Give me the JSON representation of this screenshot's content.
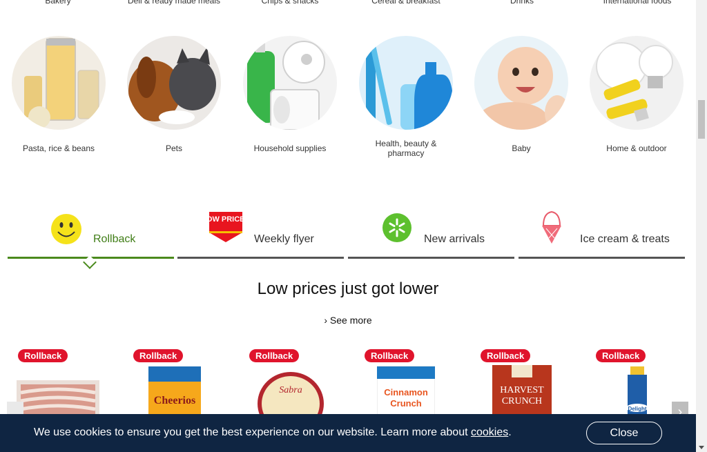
{
  "top_categories": [
    "Bakery",
    "Deli & ready made meals",
    "Chips & snacks",
    "Cereal & breakfast",
    "Drinks",
    "International foods"
  ],
  "categories": [
    {
      "label": "Pasta, rice & beans",
      "icon": "pasta-jars-image"
    },
    {
      "label": "Pets",
      "icon": "pets-image"
    },
    {
      "label": "Household supplies",
      "icon": "household-image"
    },
    {
      "label": "Health, beauty & pharmacy",
      "icon": "health-image"
    },
    {
      "label": "Baby",
      "icon": "baby-image"
    },
    {
      "label": "Home & outdoor",
      "icon": "home-image"
    }
  ],
  "tabs": [
    {
      "label": "Rollback",
      "icon": "smiley-icon",
      "active": true
    },
    {
      "label": "Weekly flyer",
      "icon": "low-prices-icon",
      "icon_text": "LOW PRICES",
      "active": false
    },
    {
      "label": "New arrivals",
      "icon": "spark-icon",
      "active": false
    },
    {
      "label": "Ice cream & treats",
      "icon": "ice-cream-icon",
      "active": false
    }
  ],
  "headline": "Low prices just got lower",
  "see_more": "› See more",
  "products": [
    {
      "badge": "Rollback",
      "name": "bacon"
    },
    {
      "badge": "Rollback",
      "name": "Honey Nut Cheerios"
    },
    {
      "badge": "Rollback",
      "name": "Sabra hummus"
    },
    {
      "badge": "Rollback",
      "name": "Cinnamon Toast Crunch"
    },
    {
      "badge": "Rollback",
      "name": "Harvest Crunch"
    },
    {
      "badge": "Rollback",
      "name": "Delight creamer"
    }
  ],
  "cookie": {
    "message": "We use cookies to ensure you get the best experience on our website. Learn more about",
    "link": "cookies",
    "period": ".",
    "close": "Close"
  },
  "colors": {
    "accent_green": "#4a8a1c",
    "badge_red": "#e0142c",
    "banner_navy": "#0f2542"
  }
}
